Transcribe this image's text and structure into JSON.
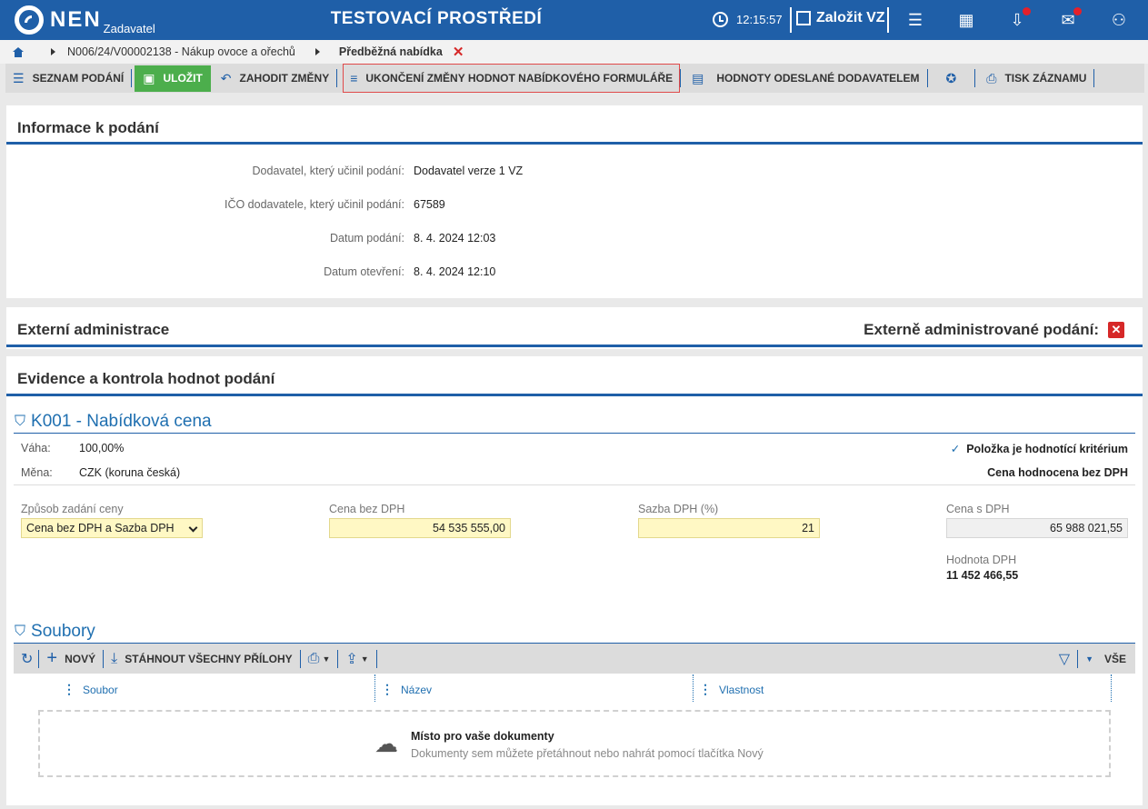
{
  "header": {
    "logo_text": "NEN",
    "logo_sub": "Zadavatel",
    "env_title": "TESTOVACÍ PROSTŘEDÍ",
    "clock": "12:15:57",
    "zalozit": "Založit VZ"
  },
  "breadcrumb": {
    "item1": "N006/24/V00002138 - Nákup ovoce a ořechů",
    "current": "Předběžná nabídka",
    "close": "✕"
  },
  "toolbar": {
    "list": "SEZNAM PODÁNÍ",
    "save": "ULOŽIT",
    "discard": "ZAHODIT ZMĚNY",
    "end_change": "UKONČENÍ ZMĚNY HODNOT NABÍDKOVÉHO FORMULÁŘE",
    "sent_values": "HODNOTY ODESLANÉ DODAVATELEM",
    "print": "TISK ZÁZNAMU"
  },
  "info": {
    "title": "Informace k podání",
    "rows": [
      {
        "label": "Dodavatel, který učinil podání:",
        "value": "Dodavatel verze 1 VZ"
      },
      {
        "label": "IČO dodavatele, který učinil podání:",
        "value": "67589"
      },
      {
        "label": "Datum podání:",
        "value": "8. 4. 2024 12:03"
      },
      {
        "label": "Datum otevření:",
        "value": "8. 4. 2024 12:10"
      }
    ]
  },
  "external": {
    "title": "Externí administrace",
    "right_label": "Externě administrované podání:",
    "x": "✕"
  },
  "evidence": {
    "title": "Evidence a kontrola hodnot podání",
    "section": "K001 - Nabídková cena",
    "vaha_label": "Váha:",
    "vaha_value": "100,00%",
    "mena_label": "Měna:",
    "mena_value": "CZK (koruna česká)",
    "criterion": "Položka je hodnotící kritérium",
    "price_eval": "Cena hodnocena bez DPH",
    "zpusob_label": "Způsob zadání ceny",
    "zpusob_value": "Cena bez DPH a Sazba DPH",
    "cena_label": "Cena bez DPH",
    "cena_value": "54 535 555,00",
    "sazba_label": "Sazba DPH (%)",
    "sazba_value": "21",
    "cena_s_label": "Cena s DPH",
    "cena_s_value": "65 988 021,55",
    "dph_label": "Hodnota DPH",
    "dph_value": "11 452 466,55"
  },
  "files": {
    "title": "Soubory",
    "new": "NOVÝ",
    "download_all": "STÁHNOUT VŠECHNY PŘÍLOHY",
    "all": "VŠE",
    "columns": [
      "Soubor",
      "Název",
      "Vlastnost"
    ],
    "drop_title": "Místo pro vaše dokumenty",
    "drop_sub": "Dokumenty sem můžete přetáhnout nebo nahrát pomocí tlačítka Nový"
  }
}
